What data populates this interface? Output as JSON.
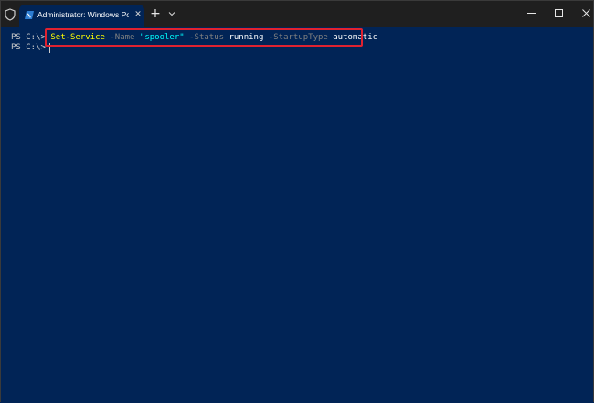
{
  "window": {
    "tab_title": "Administrator: Windows Powe",
    "close_tab_glyph": "✕",
    "new_tab_glyph": "+"
  },
  "terminal": {
    "line1": {
      "prompt": "PS C:\\> ",
      "cmdlet": "Set-Service",
      "param1": " -Name ",
      "value1": "\"spooler\"",
      "param2": " -Status ",
      "value2": "running",
      "param3": " -StartupType ",
      "value3": "automatic"
    },
    "line2": {
      "prompt": "PS C:\\> "
    }
  },
  "colors": {
    "background": "#012456",
    "titlebar": "#1f1f1f",
    "highlight_border": "#e02230",
    "cmdlet": "#ffff00",
    "parameter": "#808080",
    "string": "#00ffff"
  }
}
